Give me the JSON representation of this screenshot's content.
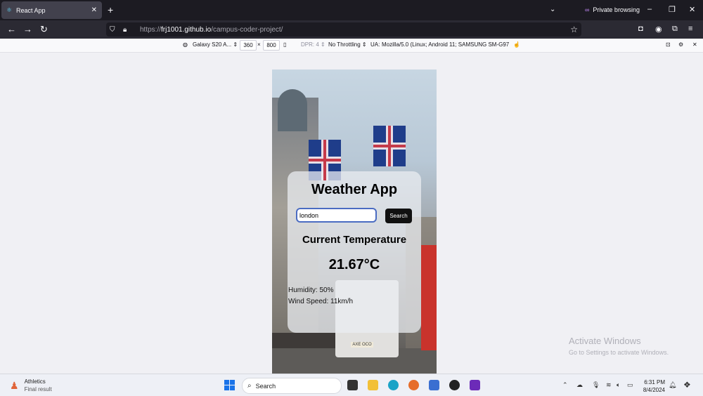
{
  "browser": {
    "tab_title": "React App",
    "tab_close_glyph": "✕",
    "new_tab_glyph": "+",
    "tab_list_glyph": "⌄",
    "private_label": "Private browsing",
    "url_host": "frj1001.github.io",
    "url_prefix": "https://",
    "url_path": "/campus-coder-project/"
  },
  "rdm": {
    "device": "Galaxy S20 A...",
    "width": "360",
    "times": "×",
    "height": "800",
    "dpr": "DPR: 4",
    "throttling": "No Throttling",
    "ua_label": "UA:",
    "ua_value": "Mozilla/5.0 (Linux; Android 11; SAMSUNG SM-G97"
  },
  "app": {
    "title": "Weather App",
    "city_value": "london",
    "search_label": "Search",
    "current_temp_label": "Current Temperature",
    "temperature": "21.67°C",
    "humidity": "Humidity: 50%",
    "wind": "Wind Speed: 11km/h",
    "bus_plate": "AXE OCO"
  },
  "watermark": {
    "line1": "Activate Windows",
    "line2": "Go to Settings to activate Windows."
  },
  "taskbar": {
    "widget_title": "Athletics",
    "widget_sub": "Final result",
    "search_placeholder": "Search",
    "time": "6:31 PM",
    "date": "8/4/2024"
  },
  "colors": {
    "accent": "#4b6cc2",
    "search_button": "#111111",
    "private_purple": "#c58af9"
  }
}
